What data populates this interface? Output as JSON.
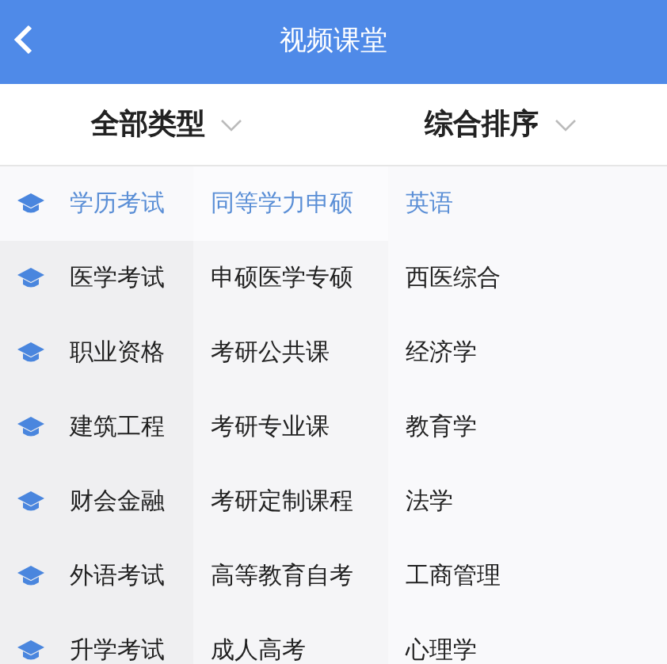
{
  "header": {
    "title": "视频课堂"
  },
  "filters": [
    {
      "label": "全部类型"
    },
    {
      "label": "综合排序"
    }
  ],
  "categories": [
    {
      "label": "学历考试",
      "selected": true
    },
    {
      "label": "医学考试",
      "selected": false
    },
    {
      "label": "职业资格",
      "selected": false
    },
    {
      "label": "建筑工程",
      "selected": false
    },
    {
      "label": "财会金融",
      "selected": false
    },
    {
      "label": "外语考试",
      "selected": false
    },
    {
      "label": "升学考试",
      "selected": false
    }
  ],
  "subcategories": [
    {
      "label": "同等学力申硕",
      "selected": true
    },
    {
      "label": "申硕医学专硕",
      "selected": false
    },
    {
      "label": "考研公共课",
      "selected": false
    },
    {
      "label": "考研专业课",
      "selected": false
    },
    {
      "label": "考研定制课程",
      "selected": false
    },
    {
      "label": "高等教育自考",
      "selected": false
    },
    {
      "label": "成人高考",
      "selected": false
    }
  ],
  "subjects": [
    {
      "label": "英语",
      "selected": true
    },
    {
      "label": "西医综合",
      "selected": false
    },
    {
      "label": "经济学",
      "selected": false
    },
    {
      "label": "教育学",
      "selected": false
    },
    {
      "label": "法学",
      "selected": false
    },
    {
      "label": "工商管理",
      "selected": false
    },
    {
      "label": "心理学",
      "selected": false
    }
  ]
}
